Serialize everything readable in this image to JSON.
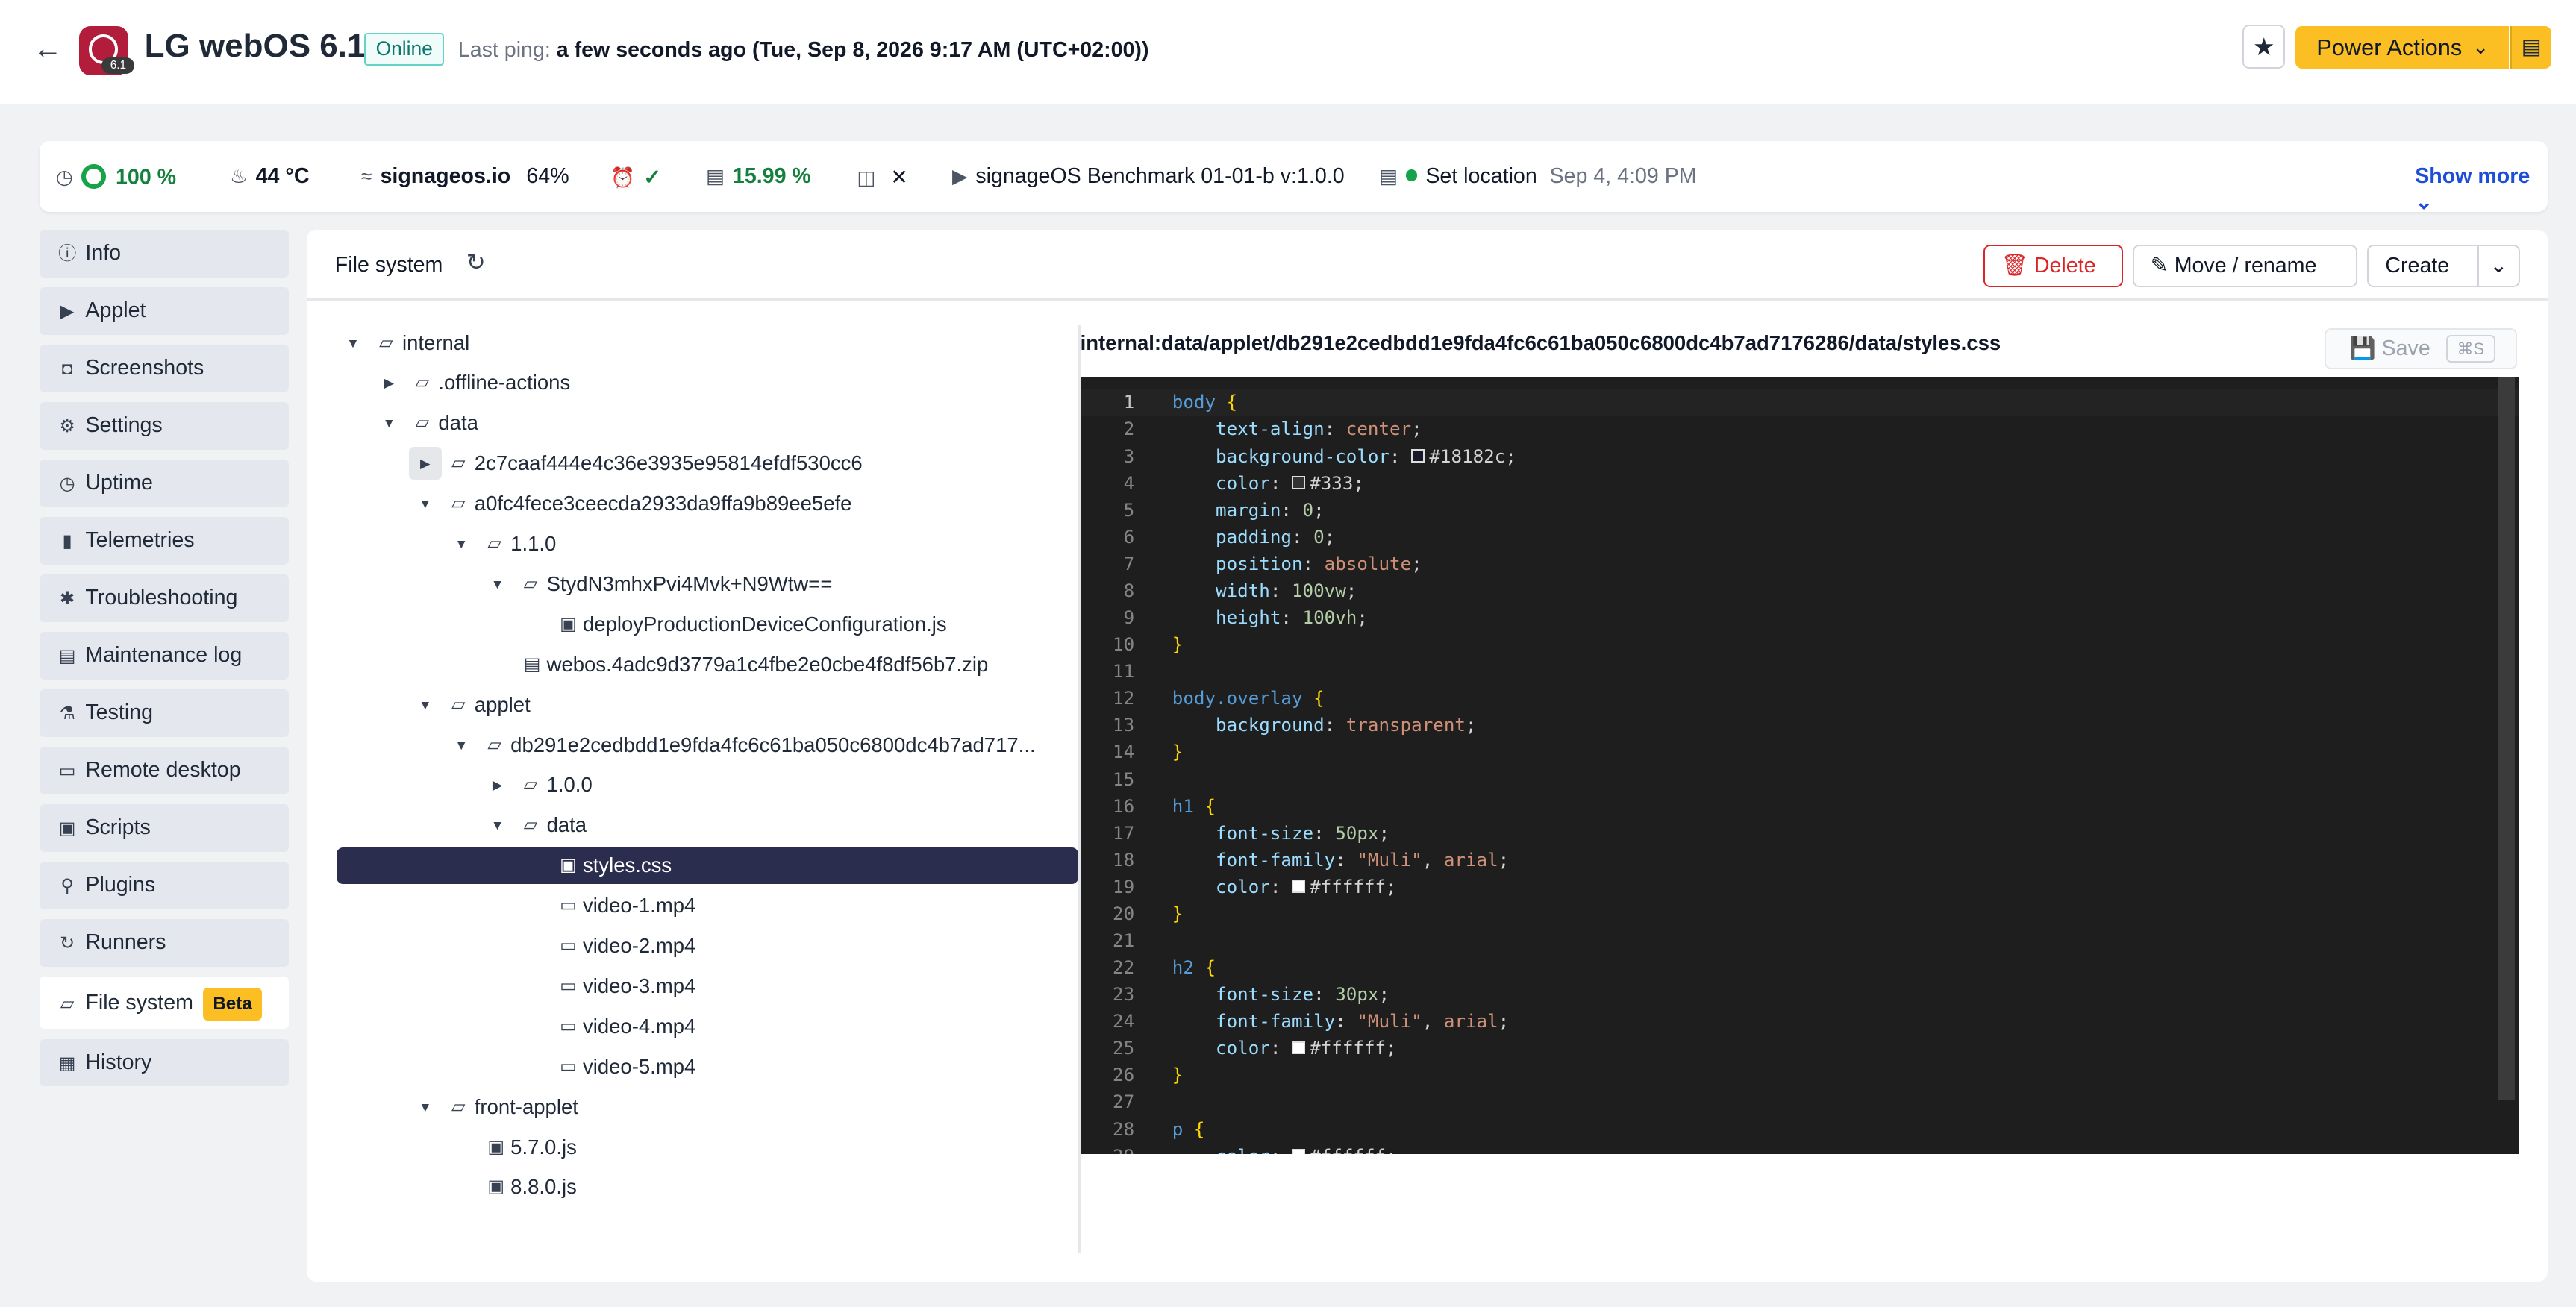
{
  "header": {
    "title": "LG webOS 6.1",
    "device_version_badge": "6.1",
    "status": "Online",
    "ping_label": "Last ping:",
    "ping_value": "a few seconds ago (Tue, Sep 8, 2026 9:17 AM (UTC+02:00))",
    "power_actions": "Power Actions"
  },
  "statusbar": {
    "battery": "100 %",
    "temperature": "44 °C",
    "network_name": "signageos.io",
    "network_strength": "64%",
    "storage": "15.99 %",
    "applet": "signageOS Benchmark 01-01-b v:1.0.0",
    "location_label": "Set location",
    "location_date": "Sep 4, 4:09 PM",
    "show_more": "Show more"
  },
  "sidebar": {
    "items": [
      {
        "label": "Info",
        "icon": "info-icon"
      },
      {
        "label": "Applet",
        "icon": "play-icon"
      },
      {
        "label": "Screenshots",
        "icon": "camera-icon"
      },
      {
        "label": "Settings",
        "icon": "gear-icon"
      },
      {
        "label": "Uptime",
        "icon": "clock-icon"
      },
      {
        "label": "Telemetries",
        "icon": "chart-icon"
      },
      {
        "label": "Troubleshooting",
        "icon": "bug-icon"
      },
      {
        "label": "Maintenance log",
        "icon": "log-icon"
      },
      {
        "label": "Testing",
        "icon": "flask-icon"
      },
      {
        "label": "Remote desktop",
        "icon": "monitor-icon"
      },
      {
        "label": "Scripts",
        "icon": "terminal-icon"
      },
      {
        "label": "Plugins",
        "icon": "plug-icon"
      },
      {
        "label": "Runners",
        "icon": "refresh-icon"
      },
      {
        "label": "File system",
        "icon": "folder-icon",
        "badge": "Beta",
        "active": true
      },
      {
        "label": "History",
        "icon": "history-icon"
      }
    ]
  },
  "panel": {
    "title": "File system",
    "delete": "Delete",
    "move_rename": "Move / rename",
    "create": "Create",
    "path": "internal:data/applet/db291e2cedbdd1e9fda4fc6c61ba050c6800dc4b7ad7176286/data/styles.css",
    "save": "Save",
    "save_shortcut": "⌘S"
  },
  "tree": [
    {
      "label": "internal",
      "type": "folder",
      "expanded": true
    },
    {
      "label": ".offline-actions",
      "type": "folder",
      "expanded": false
    },
    {
      "label": "data",
      "type": "folder",
      "expanded": true
    },
    {
      "label": "2c7caaf444e4c36e3935e95814efdf530cc6",
      "type": "folder",
      "expanded": false
    },
    {
      "label": "a0fc4fece3ceecda2933da9ffa9b89ee5efe",
      "type": "folder",
      "expanded": true
    },
    {
      "label": "1.1.0",
      "type": "folder",
      "expanded": true
    },
    {
      "label": "StydN3mhxPvi4Mvk+N9Wtw==",
      "type": "folder",
      "expanded": true
    },
    {
      "label": "deployProductionDeviceConfiguration.js",
      "type": "script"
    },
    {
      "label": "webos.4adc9d3779a1c4fbe2e0cbe4f8df56b7.zip",
      "type": "file"
    },
    {
      "label": "applet",
      "type": "folder",
      "expanded": true
    },
    {
      "label": "db291e2cedbdd1e9fda4fc6c61ba050c6800dc4b7ad717...",
      "type": "folder",
      "expanded": true
    },
    {
      "label": "1.0.0",
      "type": "folder",
      "expanded": false
    },
    {
      "label": "data",
      "type": "folder",
      "expanded": true
    },
    {
      "label": "styles.css",
      "type": "script",
      "selected": true
    },
    {
      "label": "video-1.mp4",
      "type": "video"
    },
    {
      "label": "video-2.mp4",
      "type": "video"
    },
    {
      "label": "video-3.mp4",
      "type": "video"
    },
    {
      "label": "video-4.mp4",
      "type": "video"
    },
    {
      "label": "video-5.mp4",
      "type": "video"
    },
    {
      "label": "front-applet",
      "type": "folder",
      "expanded": true
    },
    {
      "label": "5.7.0.js",
      "type": "script"
    },
    {
      "label": "8.8.0.js",
      "type": "script"
    }
  ],
  "code_lines": [
    "body {",
    "    text-align: center;",
    "    background-color: #18182c;",
    "    color: #333;",
    "    margin: 0;",
    "    padding: 0;",
    "    position: absolute;",
    "    width: 100vw;",
    "    height: 100vh;",
    "}",
    "",
    "body.overlay {",
    "    background: transparent;",
    "}",
    "",
    "h1 {",
    "    font-size: 50px;",
    "    font-family: \"Muli\", arial;",
    "    color: #ffffff;",
    "}",
    "",
    "h2 {",
    "    font-size: 30px;",
    "    font-family: \"Muli\", arial;",
    "    color: #ffffff;",
    "}",
    "",
    "p {",
    "    color: #ffffff;"
  ],
  "colors": {
    "accent": "#fbbf24",
    "selected_row": "#2b2d4e",
    "danger": "#dc2626",
    "link": "#1d4ed8",
    "editor_bg": "#1e1e1e"
  }
}
